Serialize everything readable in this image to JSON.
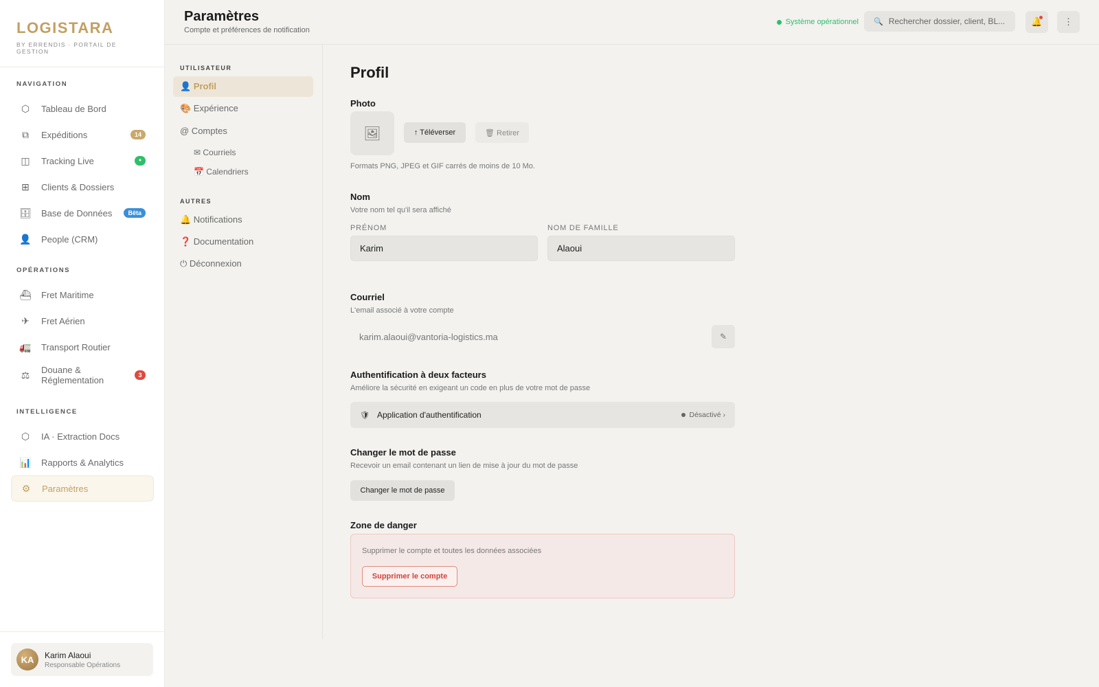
{
  "brand": {
    "name": "LOGISTARA",
    "subtitle": "BY ERRENDIS · PORTAIL DE GESTION"
  },
  "sidebar": {
    "sections": [
      {
        "title": "NAVIGATION",
        "items": [
          {
            "label": "Tableau de Bord",
            "icon": "hexagon-icon",
            "glyph": "⬡"
          },
          {
            "label": "Expéditions",
            "icon": "copy-icon",
            "glyph": "⧉",
            "badge": "14"
          },
          {
            "label": "Tracking Live",
            "icon": "map-icon",
            "glyph": "◫",
            "badge": "●"
          },
          {
            "label": "Clients & Dossiers",
            "icon": "grid-icon",
            "glyph": "⊞"
          },
          {
            "label": "Base de Données",
            "icon": "database-icon",
            "glyph": "🗄",
            "badge": "Bêta"
          },
          {
            "label": "People (CRM)",
            "icon": "person-icon",
            "glyph": "👤"
          }
        ]
      },
      {
        "title": "OPÉRATIONS",
        "items": [
          {
            "label": "Fret Maritime",
            "icon": "ship-icon",
            "glyph": "⛴"
          },
          {
            "label": "Fret Aérien",
            "icon": "plane-icon",
            "glyph": "✈"
          },
          {
            "label": "Transport Routier",
            "icon": "truck-icon",
            "glyph": "🚛"
          },
          {
            "label": "Douane & Réglementation",
            "icon": "scale-icon",
            "glyph": "⚖",
            "badge": "3"
          }
        ]
      },
      {
        "title": "INTELLIGENCE",
        "items": [
          {
            "label": "IA · Extraction Docs",
            "icon": "hexagon-ai-icon",
            "glyph": "⬡"
          },
          {
            "label": "Rapports & Analytics",
            "icon": "bar-chart-icon",
            "glyph": "📊"
          },
          {
            "label": "Paramètres",
            "icon": "gear-icon",
            "glyph": "⚙"
          }
        ]
      }
    ]
  },
  "user": {
    "initials": "KA",
    "name": "Karim Alaoui",
    "role": "Responsable Opérations"
  },
  "header": {
    "title": "Paramètres",
    "subtitle": "Compte et préférences de notification",
    "status": "Système opérationnel",
    "search_placeholder": "Rechercher dossier, client, BL...",
    "bell_icon": "🔔",
    "more_icon": "⋮"
  },
  "subnav": {
    "user_section": "UTILISATEUR",
    "other_section": "AUTRES",
    "items": {
      "profil": "👤 Profil",
      "experience": "🎨 Expérience",
      "comptes": "@ Comptes",
      "courriels": "✉ Courriels",
      "calendriers": "📅 Calendriers",
      "notifications": "🔔 Notifications",
      "documentation": "❓ Documentation",
      "deconnexion": "⏻ Déconnexion"
    }
  },
  "profile": {
    "heading": "Profil",
    "photo": {
      "title": "Photo",
      "upload": "↑ Téléverser",
      "remove": "🗑 Retirer",
      "hint": "Formats PNG, JPEG et GIF carrés de moins de 10 Mo."
    },
    "name": {
      "title": "Nom",
      "desc": "Votre nom tel qu'il sera affiché",
      "first_label": "PRÉNOM",
      "first_value": "Karim",
      "last_label": "NOM DE FAMILLE",
      "last_value": "Alaoui"
    },
    "email": {
      "title": "Courriel",
      "desc": "L'email associé à votre compte",
      "value": "karim.alaoui@vantoria-logistics.ma",
      "edit_icon": "✎"
    },
    "twofa": {
      "title": "Authentification à deux facteurs",
      "desc": "Améliore la sécurité en exigeant un code en plus de votre mot de passe",
      "label": "Application d'authentification",
      "status": "Désactivé ›"
    },
    "password": {
      "title": "Changer le mot de passe",
      "desc": "Recevoir un email contenant un lien de mise à jour du mot de passe",
      "button": "Changer le mot de passe"
    },
    "danger": {
      "title": "Zone de danger",
      "desc": "Supprimer le compte et toutes les données associées",
      "button": "Supprimer le compte"
    }
  },
  "colors": {
    "accent": "#c2a063",
    "success": "#2fbf6a",
    "danger": "#d5413a",
    "info": "#3b8fd8"
  }
}
